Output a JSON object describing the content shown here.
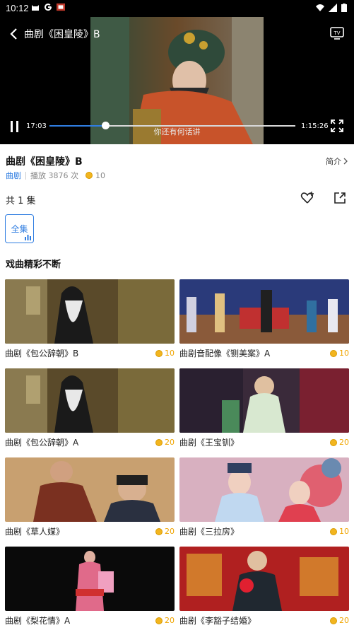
{
  "status": {
    "time": "10:12",
    "left_icons": [
      "cat-icon",
      "google-icon",
      "app-icon"
    ],
    "right_icons": [
      "wifi-icon",
      "signal-icon",
      "battery-icon"
    ]
  },
  "player": {
    "title": "曲剧《困皇陵》B",
    "current_time": "17:03",
    "total_time": "1:15:26",
    "progress": 0.226,
    "subtitle": "你还有何话讲"
  },
  "info": {
    "title": "曲剧《困皇陵》B",
    "intro_label": "简介",
    "category": "曲剧",
    "plays": "播放 3876 次",
    "coins": "10"
  },
  "episodes": {
    "count_label": "共 1 集",
    "all_label": "全集"
  },
  "section": {
    "title": "戏曲精彩不断"
  },
  "cards": [
    {
      "title": "曲剧《包公辞朝》B",
      "price": "10"
    },
    {
      "title": "曲剧音配像《铡美案》A",
      "price": "10"
    },
    {
      "title": "曲剧《包公辞朝》A",
      "price": "20"
    },
    {
      "title": "曲剧《王宝钏》",
      "price": "20"
    },
    {
      "title": "曲剧《草人媒》",
      "price": "20"
    },
    {
      "title": "曲剧《三拉房》",
      "price": "10"
    },
    {
      "title": "曲剧《梨花情》A",
      "price": "20"
    },
    {
      "title": "曲剧《李豁子结婚》",
      "price": "20"
    }
  ],
  "colors": {
    "accent": "#2f7de1",
    "coin": "#f2b51f",
    "price_text": "#f0a500"
  }
}
